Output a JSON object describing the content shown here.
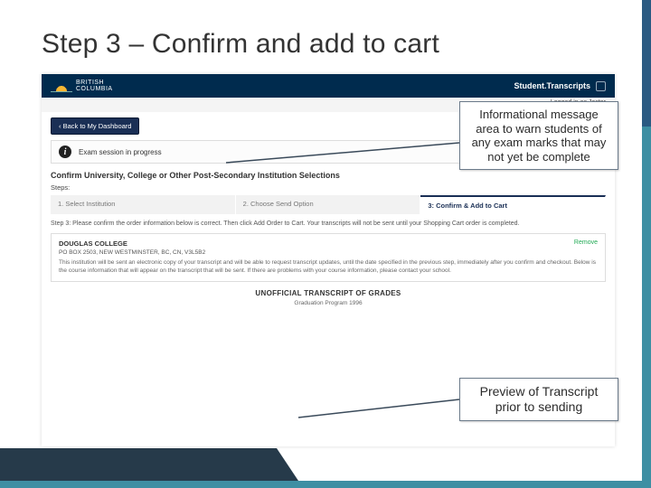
{
  "slide": {
    "title": "Step 3 – Confirm and add to cart"
  },
  "header": {
    "brand1": "BRITISH",
    "brand2": "COLUMBIA",
    "svc": "Student.Transcripts"
  },
  "status": {
    "logged": "Logged in as Jester"
  },
  "buttons": {
    "back": "‹ Back to My Dashboard"
  },
  "info": {
    "msg": "Exam session in progress"
  },
  "section": {
    "heading": "Confirm University, College or Other Post-Secondary Institution Selections",
    "steps_label": "Steps:",
    "tabs": [
      "1. Select Institution",
      "2. Choose Send Option",
      "3: Confirm & Add to Cart"
    ],
    "step_desc": "Step 3: Please confirm the order information below is correct. Then click Add Order to Cart. Your transcripts will not be sent until your Shopping Cart order is completed."
  },
  "institution": {
    "name": "DOUGLAS COLLEGE",
    "remove": "Remove",
    "addr": "PO BOX 2503, NEW WESTMINSTER, BC, CN, V3L5B2",
    "blurb": "This institution will be sent an electronic copy of your transcript and will be able to request transcript updates, until the date specified in the previous step, immediately after you confirm and checkout. Below is the course information that will appear on the transcript that will be sent. If there are problems with your course information, please contact your school."
  },
  "transcript": {
    "unofficial": "UNOFFICIAL TRANSCRIPT OF GRADES",
    "grad": "Graduation Program 1996"
  },
  "annotations": {
    "top": "Informational message area to warn students of any exam marks that may not yet be complete",
    "bottom": "Preview of Transcript prior to sending"
  }
}
